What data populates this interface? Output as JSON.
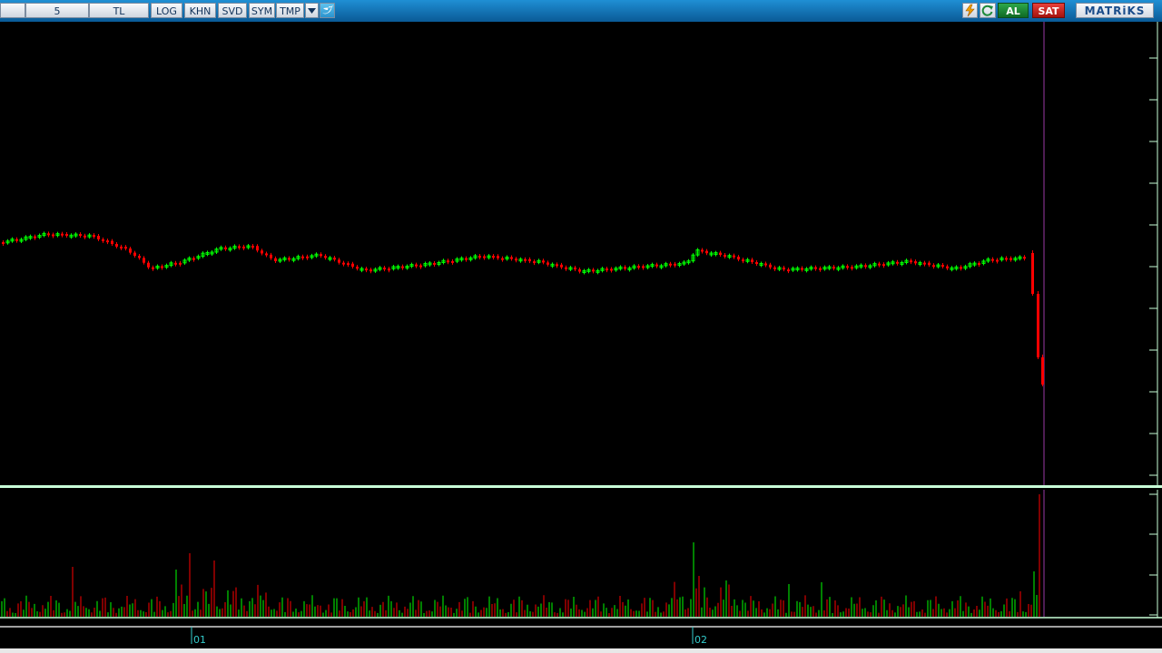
{
  "toolbar": {
    "period": "5",
    "currency": "TL",
    "log": "LOG",
    "khn": "KHN",
    "svd": "SVD",
    "sym": "SYM",
    "tmp": "TMP",
    "buy": "AL",
    "sell": "SAT",
    "brand": "MATRiKS",
    "icons": [
      "dropdown-arrow-icon",
      "twitter-bird-icon",
      "lightning-icon",
      "refresh-icon"
    ]
  },
  "time_axis": {
    "labels": [
      "01",
      "02"
    ]
  },
  "colors": {
    "up": "#00ff00",
    "down": "#ff0000",
    "background": "#000000",
    "divider": "#c8ffd8",
    "cursor": "#9a3aa6",
    "axis_label": "#33cccc"
  }
}
